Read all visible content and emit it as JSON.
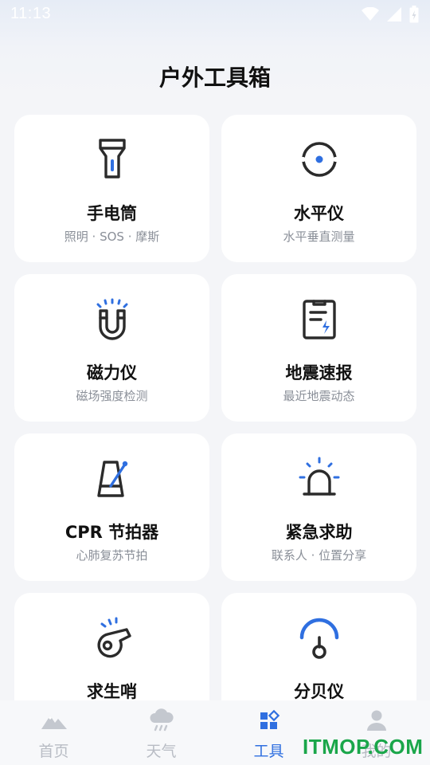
{
  "status_bar": {
    "time": "11:13"
  },
  "page": {
    "title": "户外工具箱"
  },
  "tools": [
    {
      "title": "手电筒",
      "subtitle": "照明 · SOS · 摩斯",
      "icon": "flashlight-icon"
    },
    {
      "title": "水平仪",
      "subtitle": "水平垂直测量",
      "icon": "level-icon"
    },
    {
      "title": "磁力仪",
      "subtitle": "磁场强度检测",
      "icon": "magnet-icon"
    },
    {
      "title": "地震速报",
      "subtitle": "最近地震动态",
      "icon": "clipboard-bolt-icon"
    },
    {
      "title": "CPR 节拍器",
      "subtitle": "心肺复苏节拍",
      "icon": "metronome-icon"
    },
    {
      "title": "紧急求助",
      "subtitle": "联系人 · 位置分享",
      "icon": "siren-icon"
    },
    {
      "title": "求生哨",
      "subtitle": "",
      "icon": "whistle-icon"
    },
    {
      "title": "分贝仪",
      "subtitle": "",
      "icon": "decibel-gauge-icon"
    }
  ],
  "bottom_nav": [
    {
      "label": "首页",
      "icon": "mountain-icon",
      "active": false
    },
    {
      "label": "天气",
      "icon": "cloud-rain-icon",
      "active": false
    },
    {
      "label": "工具",
      "icon": "tools-grid-icon",
      "active": true
    },
    {
      "label": "我的",
      "icon": "user-icon",
      "active": false
    }
  ],
  "watermark": "ITMOP.COM",
  "colors": {
    "accent": "#2f6fe0",
    "icon_stroke": "#2b2b2b",
    "inactive": "#b8bcc4",
    "watermark": "#1aa64a"
  }
}
